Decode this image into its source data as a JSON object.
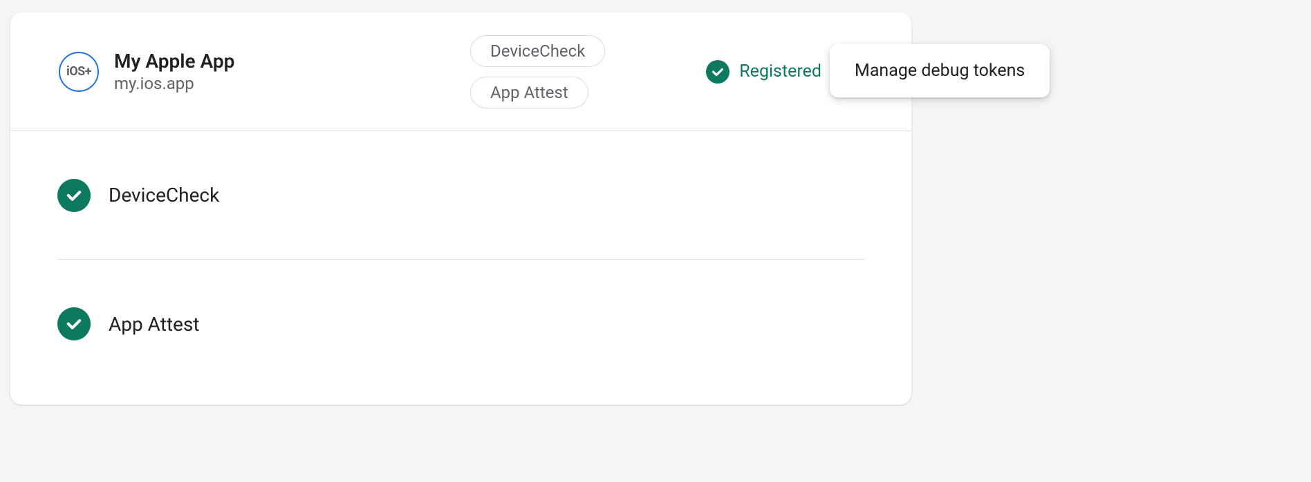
{
  "app": {
    "icon_label": "iOS+",
    "name": "My Apple App",
    "id": "my.ios.app"
  },
  "chips": [
    {
      "label": "DeviceCheck"
    },
    {
      "label": "App Attest"
    }
  ],
  "status": {
    "label": "Registered"
  },
  "providers": [
    {
      "name": "DeviceCheck"
    },
    {
      "name": "App Attest"
    }
  ],
  "menu": {
    "manage_debug_tokens": "Manage debug tokens"
  }
}
